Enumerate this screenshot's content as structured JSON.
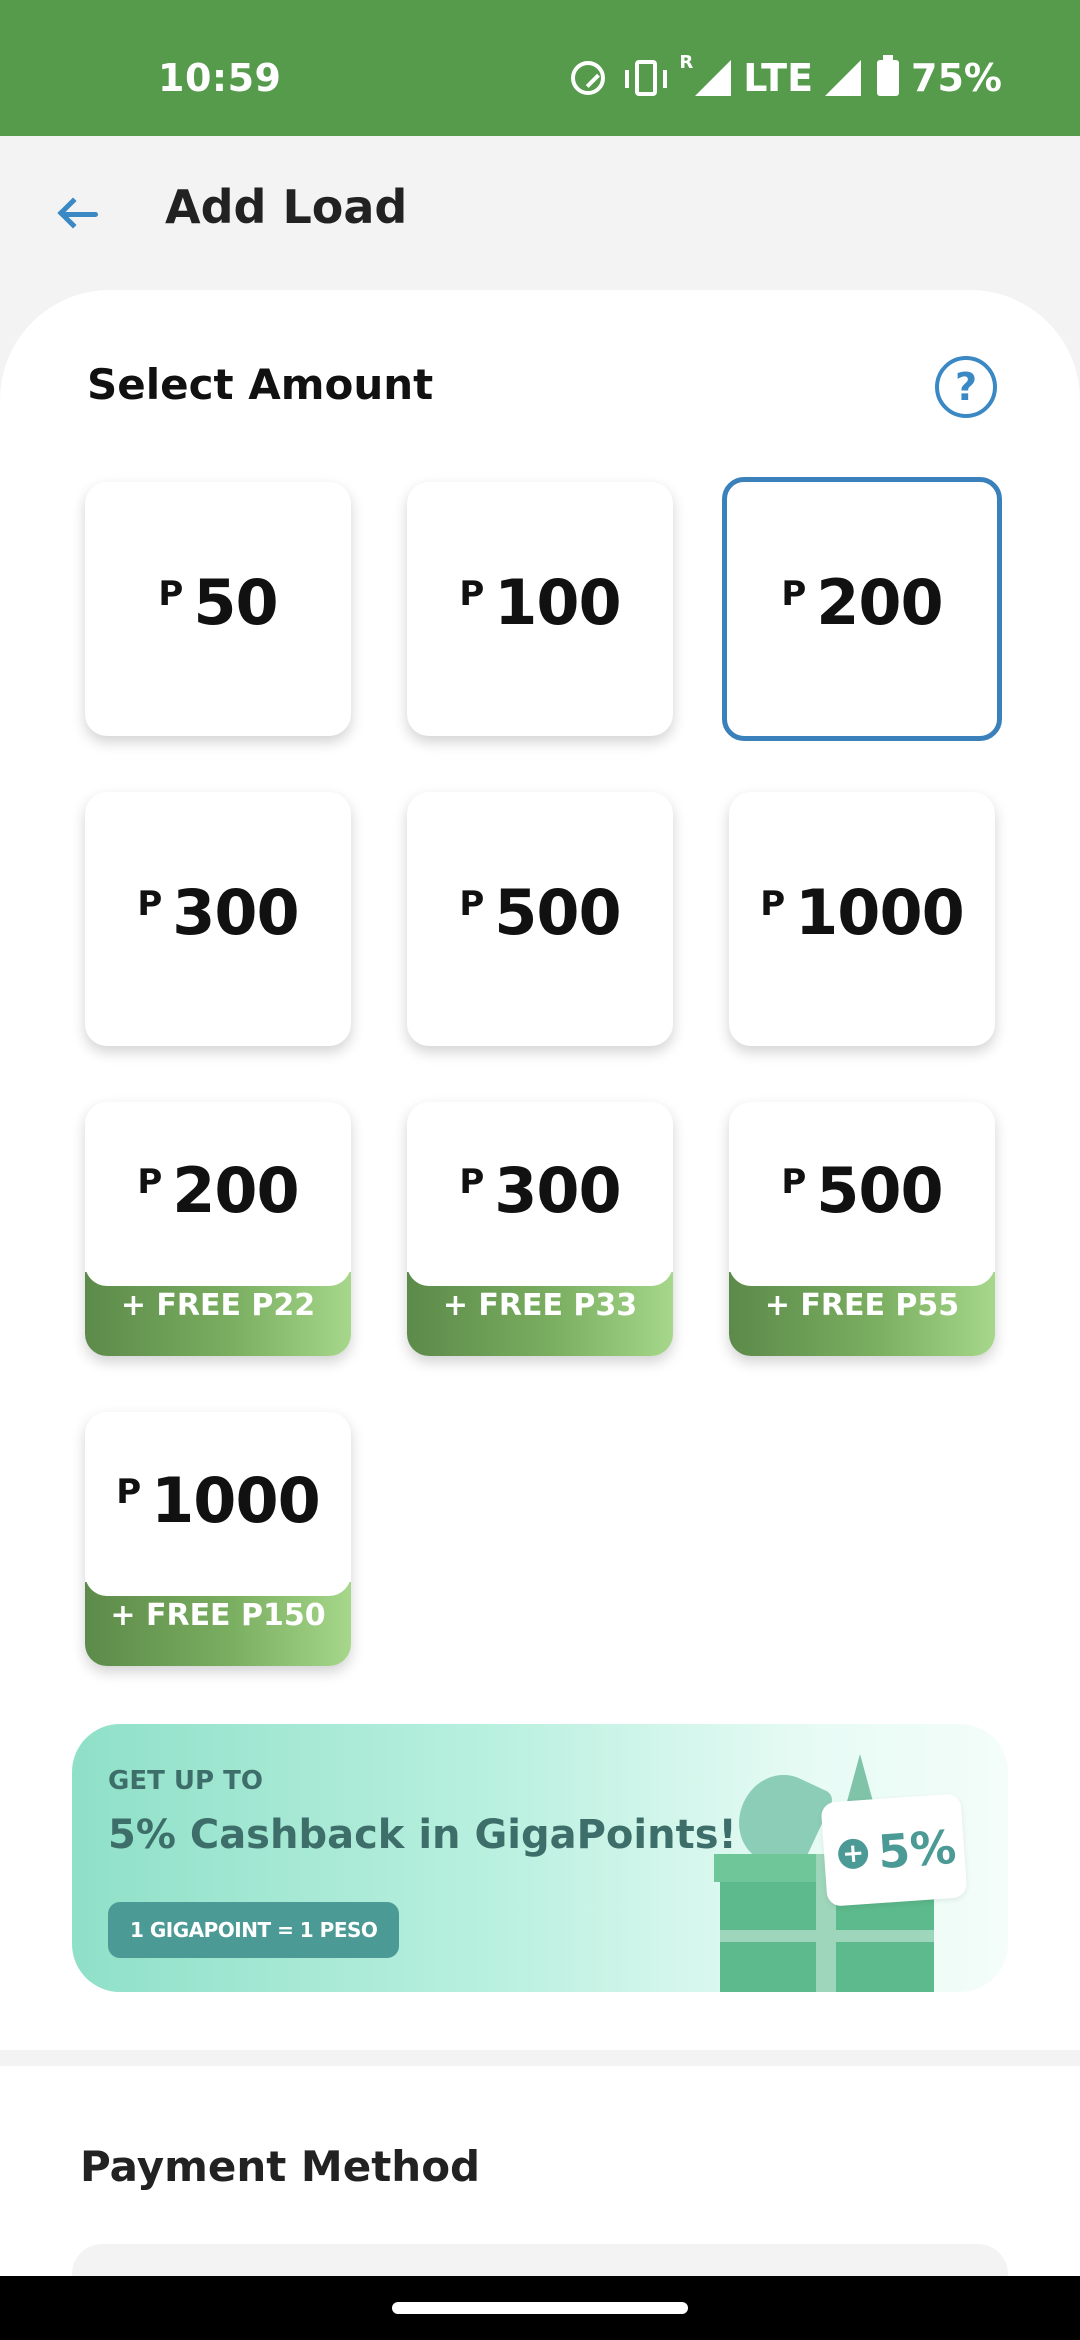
{
  "status_bar": {
    "time": "10:59",
    "roaming": "R",
    "network": "LTE",
    "battery": "75%"
  },
  "header": {
    "title": "Add Load"
  },
  "amount_section": {
    "heading": "Select Amount",
    "help_label": "?",
    "currency": "P",
    "selected": "200",
    "amounts": [
      "50",
      "100",
      "200",
      "300",
      "500",
      "1000"
    ],
    "promos": [
      {
        "value": "200",
        "bonus": "+ FREE P22"
      },
      {
        "value": "300",
        "bonus": "+ FREE P33"
      },
      {
        "value": "500",
        "bonus": "+ FREE P55"
      },
      {
        "value": "1000",
        "bonus": "+ FREE P150"
      }
    ]
  },
  "banner": {
    "eyebrow": "GET UP TO",
    "headline": "5% Cashback in GigaPoints!",
    "pill": "1 GIGAPOINT = 1 PESO",
    "badge_symbol": "+",
    "badge": "5%",
    "colors": {
      "accent": "#4b9a96",
      "background": "#b9f0df"
    }
  },
  "payment_section": {
    "heading": "Payment Method"
  },
  "colors": {
    "status_bar": "#559b4b",
    "accent_blue": "#3a88c4",
    "promo_green": "#7aae60"
  }
}
